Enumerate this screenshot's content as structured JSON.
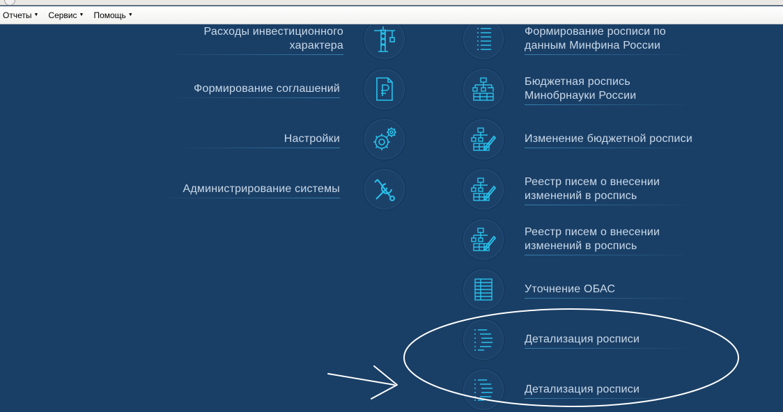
{
  "menubar": {
    "items": [
      {
        "label": "Отчеты"
      },
      {
        "label": "Сервис"
      },
      {
        "label": "Помощь"
      }
    ]
  },
  "left_column": [
    {
      "line1": "Расходы инвестиционного",
      "line2": "характера",
      "icon": "crane-icon"
    },
    {
      "line1": "Формирование соглашений",
      "line2": "",
      "icon": "ruble-document-icon"
    },
    {
      "line1": "Настройки",
      "line2": "",
      "icon": "gears-icon"
    },
    {
      "line1": "Администрирование системы",
      "line2": "",
      "icon": "tools-icon"
    }
  ],
  "right_column": [
    {
      "line1": "Формирование росписи по",
      "line2": "данным Минфина России",
      "icon": "list-icon"
    },
    {
      "line1": "Бюджетная роспись",
      "line2": "Минобрнауки России",
      "icon": "hierarchy-table-icon"
    },
    {
      "line1": "Изменение бюджетной росписи",
      "line2": "",
      "icon": "hierarchy-table-edit-icon"
    },
    {
      "line1": "Реестр писем о внесении",
      "line2": "изменений в роспись",
      "icon": "hierarchy-table-edit-icon"
    },
    {
      "line1": "Реестр писем о внесении",
      "line2": "изменений в роспись",
      "icon": "hierarchy-table-edit-icon"
    },
    {
      "line1": "Уточнение ОБАС",
      "line2": "",
      "icon": "table-icon"
    },
    {
      "line1": "Детализация росписи",
      "line2": "",
      "icon": "detail-list-icon"
    },
    {
      "line1": "Детализация росписи",
      "line2": "",
      "icon": "detail-list-icon"
    }
  ],
  "colors": {
    "background": "#1a3f66",
    "icon": "#29c3ec",
    "label": "#c9d9ea",
    "annotation": "#ffffff"
  }
}
